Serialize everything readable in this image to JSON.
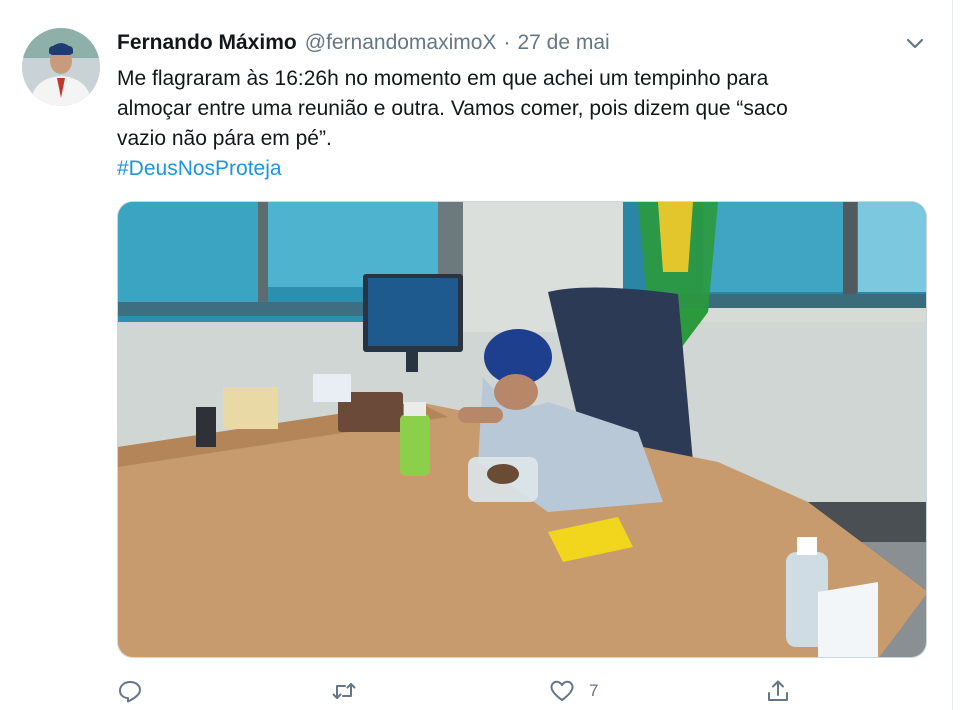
{
  "tweet": {
    "author_name": "Fernando Máximo",
    "handle": "@fernandomaximoX",
    "separator": "·",
    "date": "27 de mai",
    "text_line1": "Me flagraram às 16:26h no momento em que achei um tempinho para",
    "text_line2": "almoçar entre uma reunião e outra. Vamos comer, pois dizem que “saco",
    "text_line3": "vazio não pára em pé”.",
    "hashtag": "#DeusNosProteja",
    "like_count": "7"
  },
  "colors": {
    "text": "#14171a",
    "secondary": "#657786",
    "link": "#1b95e0"
  },
  "icons": [
    "avatar",
    "chevron-down-icon",
    "reply-icon",
    "retweet-icon",
    "like-icon",
    "share-icon"
  ]
}
